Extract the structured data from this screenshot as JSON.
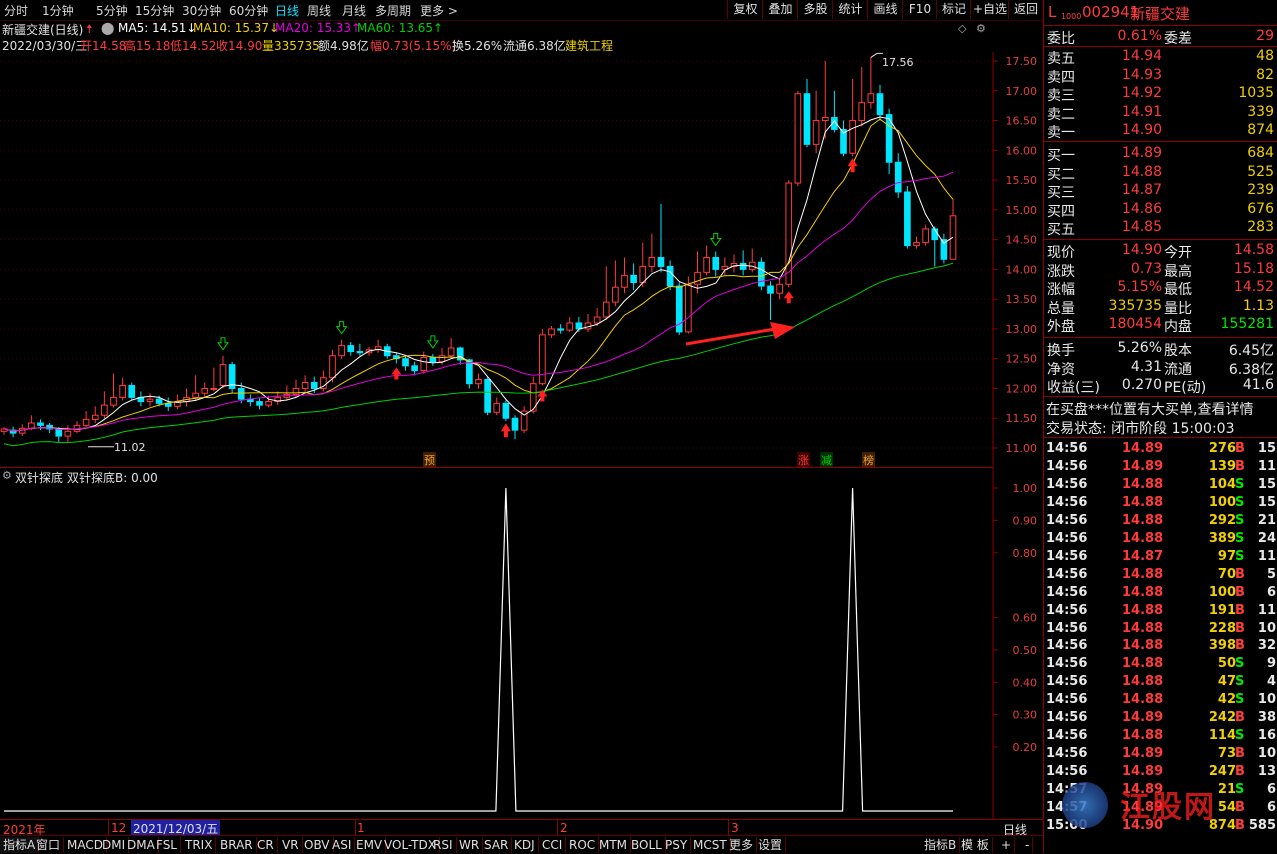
{
  "toolbar": {
    "periods": [
      "分时",
      "1分钟",
      "5分钟",
      "15分钟",
      "30分钟",
      "60分钟",
      "日线",
      "周线",
      "月线",
      "多周期",
      "更多 >"
    ],
    "active_period": "日线",
    "buttons": [
      "复权",
      "叠加",
      "多股",
      "统计",
      "画线",
      "F10",
      "标记",
      "+自选",
      "返回"
    ]
  },
  "header": {
    "title": "新疆交建(日线)",
    "ma5": "MA5: 14.51↓",
    "ma10": "MA10: 15.37↓",
    "ma20": "MA20: 15.33↑",
    "ma60": "MA60: 13.65↑",
    "date": "2022/03/30/三",
    "open": "开14.58",
    "high": "高15.18",
    "low": "低14.52",
    "close": "收14.90",
    "volume": "量335735",
    "amount": "额4.98亿",
    "change": "幅0.73(5.15%)",
    "turnover": "换5.26%",
    "float_cap": "流通6.38亿",
    "industry": "建筑工程"
  },
  "price_axis": [
    "17.50",
    "17.00",
    "16.50",
    "16.00",
    "15.50",
    "15.00",
    "14.50",
    "14.00",
    "13.50",
    "13.00",
    "12.50",
    "12.00",
    "11.50",
    "11.00"
  ],
  "price_annotations": {
    "high_label": "17.56",
    "low_label": "11.02"
  },
  "event_tags": [
    "预",
    "涨",
    "减",
    "榜"
  ],
  "indicator": {
    "title": "双针探底",
    "value_text": "双针探底B: 0.00",
    "axis": [
      "1.00",
      "0.90",
      "0.80",
      "0.60",
      "0.50",
      "0.40",
      "0.30",
      "0.20"
    ]
  },
  "date_axis": {
    "year": "2021年",
    "m12": "12",
    "selected_date": "2021/12/03/五",
    "m1": "1",
    "m2": "2",
    "m3": "3",
    "period_label": "日线"
  },
  "tabs": [
    "指标A",
    "窗口",
    "MACD",
    "DMI",
    "DMA",
    "FSL",
    "TRIX",
    "BRAR",
    "CR",
    "VR",
    "OBV",
    "ASI",
    "EMV",
    "VOL-TDX",
    "RSI",
    "WR",
    "SAR",
    "KDJ",
    "CCI",
    "ROC",
    "MTM",
    "BOLL",
    "PSY",
    "MCST",
    "更多",
    "设置"
  ],
  "tabs_right": [
    "指标B",
    "模 板",
    "+",
    "-"
  ],
  "stock": {
    "code": "002941",
    "name": "新疆交建",
    "prefix": "L",
    "sub": "1000"
  },
  "order_book": {
    "weibi_label": "委比",
    "weibi": "0.61%",
    "weicha_label": "委差",
    "weicha": "29",
    "asks": [
      {
        "label": "卖五",
        "price": "14.94",
        "vol": "48"
      },
      {
        "label": "卖四",
        "price": "14.93",
        "vol": "82"
      },
      {
        "label": "卖三",
        "price": "14.92",
        "vol": "1035"
      },
      {
        "label": "卖二",
        "price": "14.91",
        "vol": "339"
      },
      {
        "label": "卖一",
        "price": "14.90",
        "vol": "874"
      }
    ],
    "bids": [
      {
        "label": "买一",
        "price": "14.89",
        "vol": "684"
      },
      {
        "label": "买二",
        "price": "14.88",
        "vol": "525"
      },
      {
        "label": "买三",
        "price": "14.87",
        "vol": "239"
      },
      {
        "label": "买四",
        "price": "14.86",
        "vol": "676"
      },
      {
        "label": "买五",
        "price": "14.85",
        "vol": "283"
      }
    ]
  },
  "quote": [
    {
      "l": "现价",
      "v": "14.90",
      "vc": "red",
      "l2": "今开",
      "v2": "14.58",
      "v2c": "red"
    },
    {
      "l": "涨跌",
      "v": "0.73",
      "vc": "red",
      "l2": "最高",
      "v2": "15.18",
      "v2c": "red"
    },
    {
      "l": "涨幅",
      "v": "5.15%",
      "vc": "red",
      "l2": "最低",
      "v2": "14.52",
      "v2c": "red"
    },
    {
      "l": "总量",
      "v": "335735",
      "vc": "yellow",
      "l2": "量比",
      "v2": "1.13",
      "v2c": "yellow"
    },
    {
      "l": "外盘",
      "v": "180454",
      "vc": "red",
      "l2": "内盘",
      "v2": "155281",
      "v2c": "green"
    }
  ],
  "fundamentals": [
    {
      "l": "换手",
      "v": "5.26%",
      "l2": "股本",
      "v2": "6.45亿"
    },
    {
      "l": "净资",
      "v": "4.31",
      "l2": "流通",
      "v2": "6.38亿"
    },
    {
      "l": "收益(三)",
      "v": "0.270",
      "l2": "PE(动)",
      "v2": "41.6"
    }
  ],
  "notice": "在买盘***位置有大买单,查看详情",
  "status_label": "交易状态: 闭市阶段 15:00:03",
  "ticks": [
    {
      "t": "14:56",
      "p": "14.89",
      "v": "276",
      "s": "B",
      "n": "15"
    },
    {
      "t": "14:56",
      "p": "14.89",
      "v": "139",
      "s": "B",
      "n": "11"
    },
    {
      "t": "14:56",
      "p": "14.88",
      "v": "104",
      "s": "S",
      "n": "15"
    },
    {
      "t": "14:56",
      "p": "14.88",
      "v": "100",
      "s": "S",
      "n": "15"
    },
    {
      "t": "14:56",
      "p": "14.88",
      "v": "292",
      "s": "S",
      "n": "21"
    },
    {
      "t": "14:56",
      "p": "14.88",
      "v": "389",
      "s": "S",
      "n": "24"
    },
    {
      "t": "14:56",
      "p": "14.87",
      "v": "97",
      "s": "S",
      "n": "11"
    },
    {
      "t": "14:56",
      "p": "14.88",
      "v": "70",
      "s": "B",
      "n": "5"
    },
    {
      "t": "14:56",
      "p": "14.88",
      "v": "100",
      "s": "B",
      "n": "6"
    },
    {
      "t": "14:56",
      "p": "14.88",
      "v": "191",
      "s": "B",
      "n": "11"
    },
    {
      "t": "14:56",
      "p": "14.88",
      "v": "228",
      "s": "B",
      "n": "10"
    },
    {
      "t": "14:56",
      "p": "14.88",
      "v": "398",
      "s": "B",
      "n": "32"
    },
    {
      "t": "14:56",
      "p": "14.88",
      "v": "50",
      "s": "S",
      "n": "9"
    },
    {
      "t": "14:56",
      "p": "14.88",
      "v": "47",
      "s": "S",
      "n": "4"
    },
    {
      "t": "14:56",
      "p": "14.88",
      "v": "42",
      "s": "S",
      "n": "10"
    },
    {
      "t": "14:56",
      "p": "14.89",
      "v": "242",
      "s": "B",
      "n": "38"
    },
    {
      "t": "14:56",
      "p": "14.88",
      "v": "114",
      "s": "S",
      "n": "16"
    },
    {
      "t": "14:56",
      "p": "14.89",
      "v": "73",
      "s": "B",
      "n": "10"
    },
    {
      "t": "14:56",
      "p": "14.89",
      "v": "247",
      "s": "B",
      "n": "13"
    },
    {
      "t": "14:57",
      "p": "14.89",
      "v": "21",
      "s": "S",
      "n": "6"
    },
    {
      "t": "14:57",
      "p": "14.89",
      "v": "54",
      "s": "B",
      "n": "6"
    },
    {
      "t": "15:00",
      "p": "14.90",
      "v": "874",
      "s": "B",
      "n": "585"
    }
  ],
  "watermark": "江股网",
  "colors": {
    "up": "#ff3b3b",
    "down": "#00e5ff",
    "ma5": "#ffffff",
    "ma10": "#f0d000",
    "ma20": "#e000e0",
    "ma60": "#00d000"
  },
  "chart_data": {
    "type": "candlestick",
    "price_range": [
      10.85,
      17.75
    ],
    "candles": [
      [
        11.28,
        11.32,
        11.22,
        11.35
      ],
      [
        11.3,
        11.25,
        11.18,
        11.36
      ],
      [
        11.25,
        11.33,
        11.2,
        11.4
      ],
      [
        11.33,
        11.42,
        11.3,
        11.55
      ],
      [
        11.42,
        11.38,
        11.3,
        11.48
      ],
      [
        11.38,
        11.32,
        11.25,
        11.42
      ],
      [
        11.32,
        11.2,
        11.1,
        11.35
      ],
      [
        11.2,
        11.28,
        11.1,
        11.38
      ],
      [
        11.28,
        11.38,
        11.25,
        11.45
      ],
      [
        11.38,
        11.48,
        11.35,
        11.62
      ],
      [
        11.48,
        11.55,
        11.42,
        11.7
      ],
      [
        11.55,
        11.72,
        11.5,
        11.95
      ],
      [
        11.72,
        11.85,
        11.68,
        12.25
      ],
      [
        11.85,
        12.05,
        11.8,
        12.18
      ],
      [
        12.05,
        11.85,
        11.8,
        12.1
      ],
      [
        11.85,
        11.78,
        11.7,
        11.95
      ],
      [
        11.78,
        11.82,
        11.7,
        11.92
      ],
      [
        11.82,
        11.75,
        11.7,
        11.88
      ],
      [
        11.75,
        11.7,
        11.62,
        11.85
      ],
      [
        11.7,
        11.78,
        11.65,
        11.9
      ],
      [
        11.78,
        11.85,
        11.7,
        12.0
      ],
      [
        11.85,
        11.92,
        11.8,
        12.22
      ],
      [
        11.92,
        12.0,
        11.85,
        12.1
      ],
      [
        12.0,
        12.0,
        11.95,
        12.35
      ],
      [
        12.05,
        12.4,
        12.0,
        12.55
      ],
      [
        12.4,
        12.0,
        11.92,
        12.45
      ],
      [
        12.0,
        11.82,
        11.75,
        12.1
      ],
      [
        11.82,
        11.78,
        11.7,
        11.9
      ],
      [
        11.78,
        11.72,
        11.65,
        11.85
      ],
      [
        11.72,
        11.78,
        11.68,
        11.88
      ],
      [
        11.78,
        11.85,
        11.72,
        11.95
      ],
      [
        11.85,
        11.9,
        11.8,
        12.05
      ],
      [
        11.9,
        12.0,
        11.85,
        12.15
      ],
      [
        12.0,
        12.1,
        11.95,
        12.22
      ],
      [
        12.1,
        12.0,
        11.92,
        12.2
      ],
      [
        12.0,
        12.18,
        11.95,
        12.3
      ],
      [
        12.18,
        12.55,
        12.1,
        12.65
      ],
      [
        12.55,
        12.72,
        12.5,
        12.82
      ],
      [
        12.72,
        12.62,
        12.55,
        12.78
      ],
      [
        12.62,
        12.6,
        12.55,
        12.75
      ],
      [
        12.6,
        12.65,
        12.55,
        12.7
      ],
      [
        12.65,
        12.7,
        12.6,
        12.82
      ],
      [
        12.7,
        12.55,
        12.5,
        12.75
      ],
      [
        12.55,
        12.5,
        12.42,
        12.6
      ],
      [
        12.5,
        12.38,
        12.3,
        12.55
      ],
      [
        12.38,
        12.3,
        12.22,
        12.45
      ],
      [
        12.3,
        12.52,
        12.25,
        12.62
      ],
      [
        12.52,
        12.45,
        12.38,
        12.58
      ],
      [
        12.45,
        12.55,
        12.4,
        12.68
      ],
      [
        12.55,
        12.68,
        12.5,
        12.85
      ],
      [
        12.68,
        12.48,
        12.4,
        12.7
      ],
      [
        12.48,
        12.08,
        12.0,
        12.5
      ],
      [
        12.08,
        12.15,
        12.0,
        12.25
      ],
      [
        12.15,
        11.6,
        11.55,
        12.2
      ],
      [
        11.6,
        11.75,
        11.55,
        11.85
      ],
      [
        11.75,
        11.5,
        11.45,
        11.8
      ],
      [
        11.5,
        11.3,
        11.15,
        11.55
      ],
      [
        11.3,
        11.62,
        11.25,
        11.7
      ],
      [
        11.62,
        12.08,
        11.58,
        12.2
      ],
      [
        12.08,
        12.9,
        12.05,
        13.0
      ],
      [
        12.9,
        13.0,
        12.85,
        13.05
      ],
      [
        13.0,
        12.98,
        12.92,
        13.08
      ],
      [
        12.98,
        13.1,
        12.95,
        13.2
      ],
      [
        13.1,
        13.0,
        12.95,
        13.2
      ],
      [
        13.0,
        13.1,
        12.95,
        13.25
      ],
      [
        13.1,
        13.2,
        13.05,
        13.35
      ],
      [
        13.2,
        13.45,
        13.15,
        14.05
      ],
      [
        13.45,
        13.7,
        13.38,
        14.15
      ],
      [
        13.7,
        13.9,
        13.6,
        14.2
      ],
      [
        13.9,
        13.78,
        13.65,
        14.1
      ],
      [
        13.78,
        14.05,
        13.7,
        14.45
      ],
      [
        14.05,
        14.2,
        13.95,
        14.6
      ],
      [
        14.2,
        14.05,
        13.95,
        15.1
      ],
      [
        14.05,
        13.72,
        13.65,
        14.15
      ],
      [
        13.72,
        12.95,
        12.9,
        13.78
      ],
      [
        12.95,
        13.75,
        12.92,
        13.88
      ],
      [
        13.75,
        13.95,
        13.6,
        14.3
      ],
      [
        13.95,
        14.2,
        13.9,
        14.4
      ],
      [
        14.2,
        14.0,
        13.88,
        14.3
      ],
      [
        14.0,
        14.05,
        13.9,
        14.2
      ],
      [
        14.05,
        14.1,
        13.95,
        14.25
      ],
      [
        14.1,
        14.0,
        13.9,
        14.32
      ],
      [
        14.0,
        14.12,
        13.95,
        14.35
      ],
      [
        14.12,
        13.72,
        13.65,
        14.2
      ],
      [
        13.72,
        13.6,
        13.15,
        13.8
      ],
      [
        13.6,
        13.75,
        13.5,
        13.85
      ],
      [
        13.75,
        15.45,
        13.7,
        15.5
      ],
      [
        15.45,
        16.95,
        15.4,
        17.0
      ],
      [
        16.95,
        16.1,
        16.05,
        17.2
      ],
      [
        16.1,
        16.5,
        15.95,
        17.0
      ],
      [
        16.5,
        16.55,
        16.2,
        17.5
      ],
      [
        16.55,
        16.35,
        16.3,
        17.0
      ],
      [
        16.35,
        15.95,
        15.9,
        16.5
      ],
      [
        15.95,
        16.5,
        15.9,
        17.2
      ],
      [
        16.5,
        16.8,
        16.4,
        17.4
      ],
      [
        16.8,
        16.95,
        16.7,
        17.56
      ],
      [
        16.95,
        16.6,
        16.5,
        17.1
      ],
      [
        16.6,
        15.8,
        15.6,
        16.7
      ],
      [
        15.8,
        15.3,
        15.2,
        15.95
      ],
      [
        15.3,
        14.4,
        14.35,
        15.4
      ],
      [
        14.4,
        14.45,
        14.35,
        14.55
      ],
      [
        14.45,
        14.68,
        14.4,
        14.75
      ],
      [
        14.68,
        14.5,
        14.05,
        14.72
      ],
      [
        14.5,
        14.17,
        14.1,
        14.6
      ],
      [
        14.17,
        14.9,
        14.52,
        15.18
      ]
    ],
    "ma5_end": 14.51,
    "ma10_end": 15.37,
    "ma20_end": 15.33,
    "ma60_end": 13.65,
    "signal_series": {
      "name": "双针探底B",
      "spikes_at_index": [
        55,
        93
      ],
      "value": 1.0
    }
  }
}
